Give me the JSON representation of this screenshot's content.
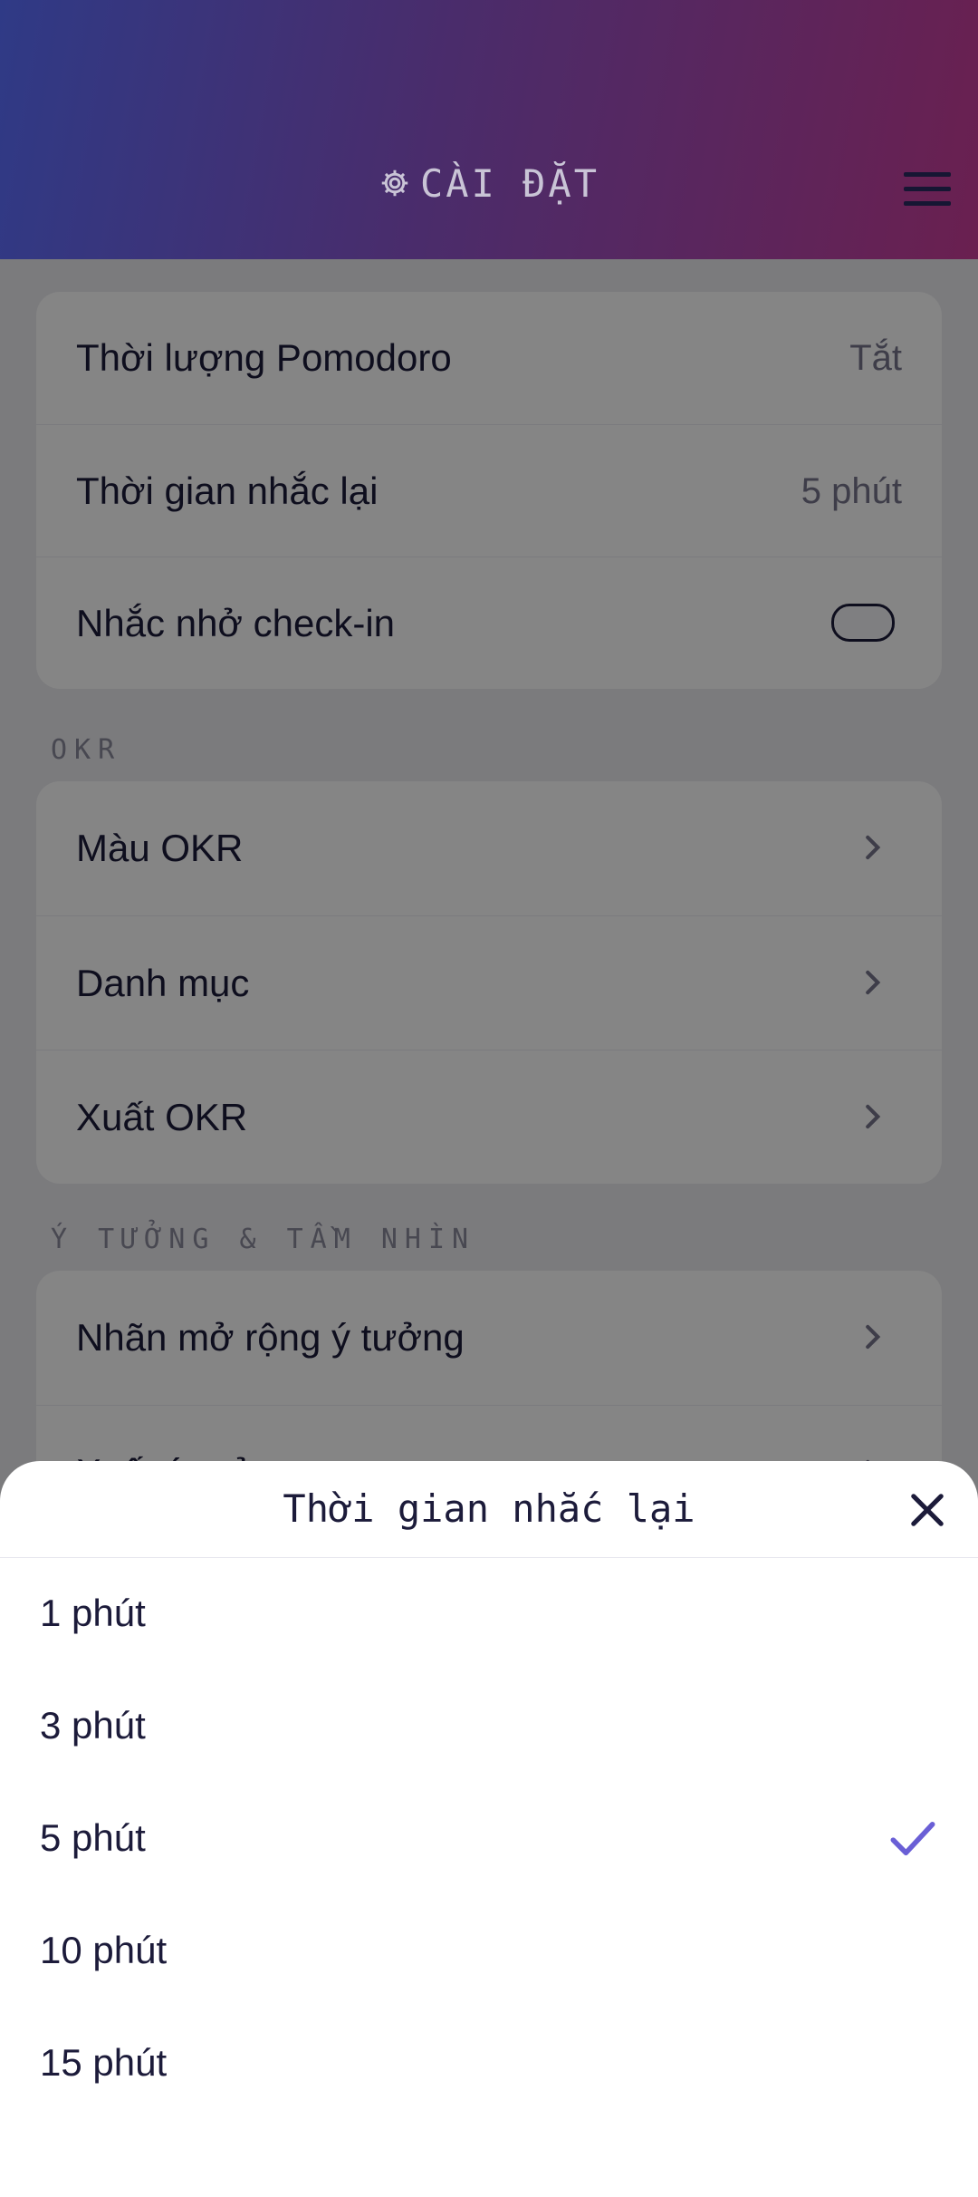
{
  "header": {
    "title": "CÀI ĐẶT",
    "gear_icon": "gear-icon",
    "menu_icon": "hamburger-menu-icon"
  },
  "settings": {
    "pomodoro": {
      "label": "Thời lượng Pomodoro",
      "value": "Tắt"
    },
    "reminder": {
      "label": "Thời gian nhắc lại",
      "value": "5 phút"
    },
    "checkin": {
      "label": "Nhắc nhở check-in",
      "enabled": false
    }
  },
  "okr": {
    "section_title": "OKR",
    "items": [
      {
        "label": "Màu OKR"
      },
      {
        "label": "Danh mục"
      },
      {
        "label": "Xuất OKR"
      }
    ]
  },
  "ideas": {
    "section_title": "Ý TƯỞNG & TẦM NHÌN",
    "items": [
      {
        "label": "Nhãn mở rộng ý tưởng"
      },
      {
        "label": "Xuất ý tưởng"
      }
    ]
  },
  "sheet": {
    "title": "Thời gian nhắc lại",
    "options": [
      {
        "label": "1 phút",
        "selected": false
      },
      {
        "label": "3 phút",
        "selected": false
      },
      {
        "label": "5 phút",
        "selected": true
      },
      {
        "label": "10 phút",
        "selected": false
      },
      {
        "label": "15 phút",
        "selected": false
      }
    ],
    "accent_color": "#6a5fd6"
  }
}
